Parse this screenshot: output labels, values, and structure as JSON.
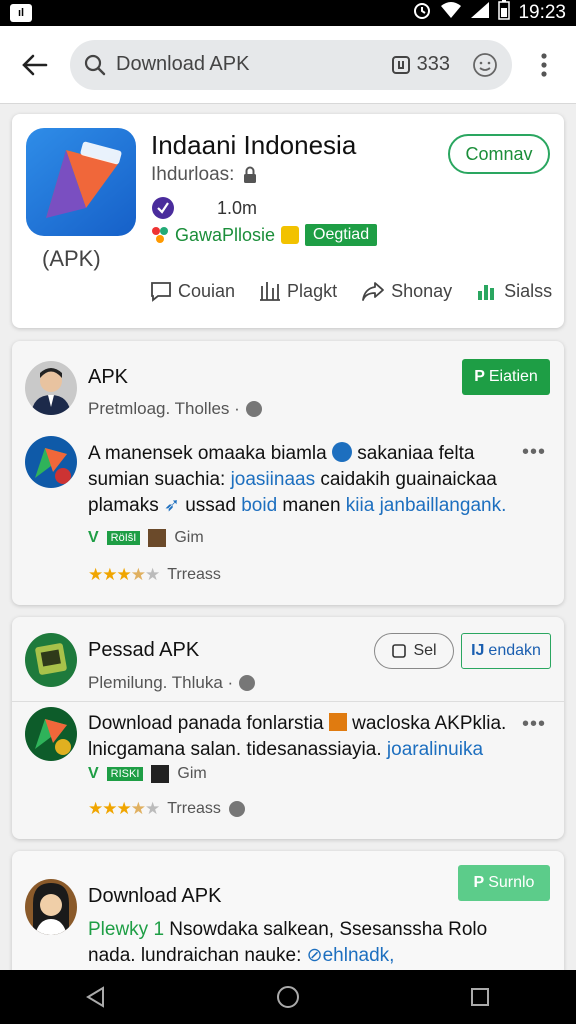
{
  "status_bar": {
    "left_badge": "ıl",
    "time": "19:23"
  },
  "search": {
    "placeholder": "Download APK",
    "count": "333"
  },
  "app": {
    "title": "Indaani Indonesia",
    "subtitle": "Ihdurloas:",
    "downloads": "1.0m",
    "tag_text": "GawaPllosie",
    "badge": "Oegtiad",
    "apk_label": "(APK)",
    "install_label": "Comnav",
    "actions": [
      {
        "label": "Couian",
        "icon": "comment-icon"
      },
      {
        "label": "Plagkt",
        "icon": "bookmark-icon"
      },
      {
        "label": "Shonay",
        "icon": "share-icon"
      },
      {
        "label": "Sialss",
        "icon": "stats-icon"
      }
    ]
  },
  "posts": [
    {
      "title": "APK",
      "subtitle": "Pretmloag. Tholles ·",
      "button": "Eiatien",
      "body_plain_1": "A manensek omaaka biamla ",
      "body_plain_2": " sakaniaa felta sumian suachia: ",
      "body_link_1": "joasiinaas",
      "body_plain_3": " caidakih guainaickaa plamaks ",
      "body_plain_4": " ussad ",
      "body_link_2": "boid",
      "body_plain_5": " manen ",
      "body_link_3": "kiia janbaillangank.",
      "verify_badge": "RöIŝI",
      "verify_text": "Gim",
      "rating_text": "Trreass",
      "rating": 3.5
    },
    {
      "title": "Pessad APK",
      "subtitle": "Plemilung. Thluka ·",
      "button_outline": "Sel",
      "button_green": "endakn",
      "body_plain_1": "Download panada fonlarstia ",
      "body_plain_2": " wacloska AKPklia. lnicgamana salan. tidesanassiayia. ",
      "body_link_1": "joaralinuika",
      "verify_badge": "RISKI",
      "verify_text": "Gim",
      "rating_text": "Trreass",
      "rating": 3.5
    },
    {
      "title": "Download APK",
      "button": "Surnlo",
      "body_link_1": "Plewky 1",
      "body_plain_1": " Nsowdaka salkean, Ssesanssha Rolo nada. lundraichan nauke: ",
      "body_link_2": "⊘ehlnadk, ndagairingcegnanl"
    }
  ],
  "colors": {
    "accent_green": "#1e9e45",
    "link_blue": "#1d6fbf",
    "star": "#f0a500"
  }
}
